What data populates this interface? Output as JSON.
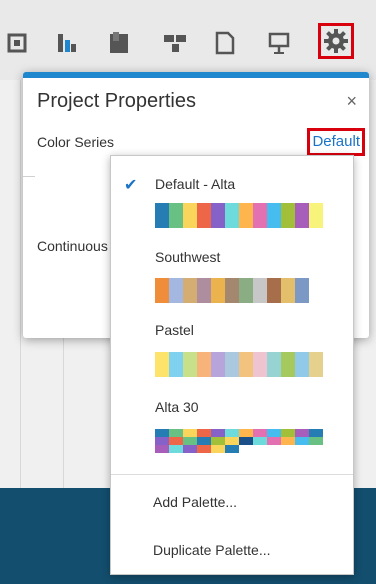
{
  "toolbar": {
    "icons": [
      "table-icon",
      "chart-icon",
      "book-icon",
      "flow-icon",
      "page-icon",
      "presentation-icon",
      "gear-icon"
    ]
  },
  "dialog": {
    "title": "Project Properties",
    "close": "×",
    "color_series_label": "Color Series",
    "color_series_value": "Default",
    "continuous_label": "Continuous"
  },
  "dropdown": {
    "palettes": [
      {
        "name": "Default - Alta",
        "selected": true,
        "colors": [
          "#267db3",
          "#68c182",
          "#fad55c",
          "#ed6647",
          "#8561c8",
          "#6ddbdb",
          "#ffb54d",
          "#e371b2",
          "#47bdef",
          "#a2bf39",
          "#a75dba",
          "#f7f37b"
        ]
      },
      {
        "name": "Southwest",
        "selected": false,
        "colors": [
          "#ef8d3a",
          "#a3b7e0",
          "#d4ad73",
          "#ae8e9e",
          "#ebb34e",
          "#a3886f",
          "#8bad83",
          "#c7c7c7",
          "#a76e4b",
          "#e3bf6b",
          "#7c98c4"
        ]
      },
      {
        "name": "Pastel",
        "selected": false,
        "colors": [
          "#fde36a",
          "#80d1ef",
          "#c8e08a",
          "#f8b37a",
          "#b6a4db",
          "#aac8de",
          "#f1c37e",
          "#edc4cf",
          "#98d3d3",
          "#a6c95e",
          "#91c9e8",
          "#e5d08e"
        ]
      },
      {
        "name": "Alta 30",
        "selected": false,
        "grid": [
          [
            "#267db3",
            "#68c182",
            "#fad55c",
            "#ed6647",
            "#8561c8",
            "#6ddbdb",
            "#ffb54d",
            "#e371b2",
            "#47bdef",
            "#a2bf39",
            "#a75dba",
            "#267db3"
          ],
          [
            "#8561c8",
            "#ed6647",
            "#68c182",
            "#267db3",
            "#a2bf39",
            "#fad55c",
            "#1b4f8a",
            "#6ddbdb",
            "#e371b2",
            "#ffb54d",
            "#47bdef",
            "#68c182"
          ],
          [
            "#a75dba",
            "#6ddbdb",
            "#8561c8",
            "#ed6647",
            "#fad55c",
            "#267db3"
          ]
        ]
      }
    ],
    "actions": [
      "Add Palette...",
      "Duplicate Palette..."
    ]
  }
}
